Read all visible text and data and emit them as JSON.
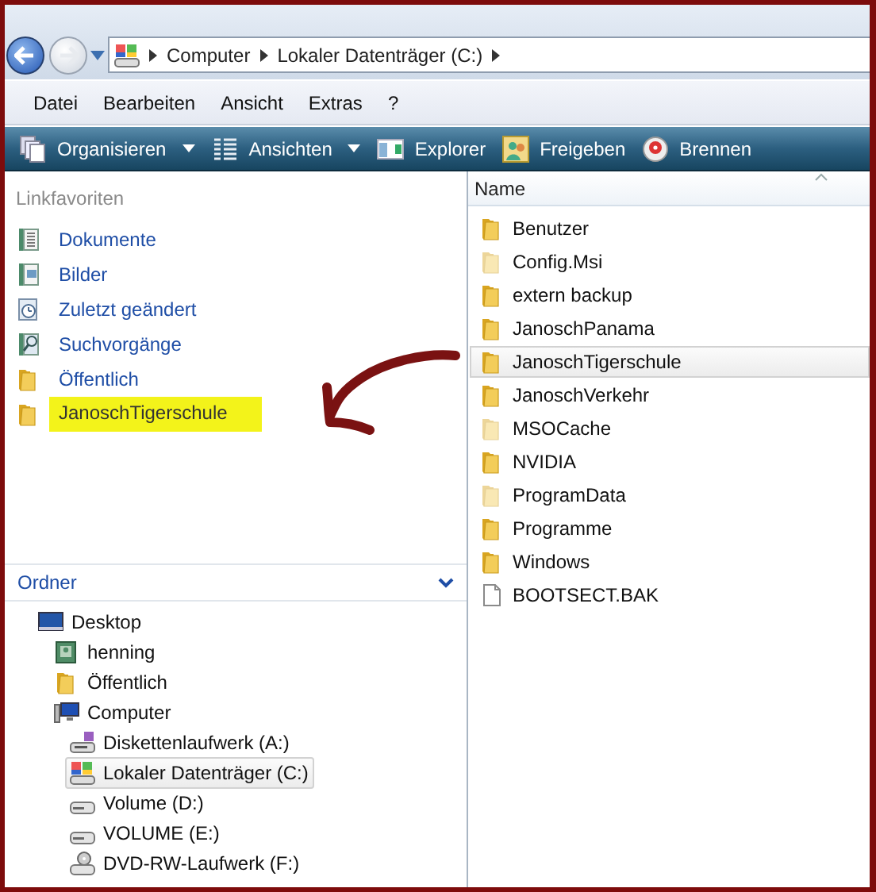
{
  "nav": {
    "back_enabled": true,
    "forward_enabled": false,
    "breadcrumb": [
      "Computer",
      "Lokaler Datenträger (C:)"
    ]
  },
  "menu": [
    "Datei",
    "Bearbeiten",
    "Ansicht",
    "Extras",
    "?"
  ],
  "toolbar": [
    {
      "label": "Organisieren",
      "kind": "organize",
      "dropdown": true
    },
    {
      "label": "Ansichten",
      "kind": "views",
      "dropdown": true
    },
    {
      "label": "Explorer",
      "kind": "explorer",
      "dropdown": false
    },
    {
      "label": "Freigeben",
      "kind": "share",
      "dropdown": false
    },
    {
      "label": "Brennen",
      "kind": "burn",
      "dropdown": false
    }
  ],
  "favorites": {
    "title": "Linkfavoriten",
    "items": [
      {
        "label": "Dokumente",
        "kind": "documents",
        "highlighted": false
      },
      {
        "label": "Bilder",
        "kind": "pictures",
        "highlighted": false
      },
      {
        "label": "Zuletzt geändert",
        "kind": "recent",
        "highlighted": false
      },
      {
        "label": "Suchvorgänge",
        "kind": "searches",
        "highlighted": false
      },
      {
        "label": "Öffentlich",
        "kind": "folder",
        "highlighted": false
      },
      {
        "label": "JanoschTigerschule",
        "kind": "folder",
        "highlighted": true
      }
    ]
  },
  "annotation": {
    "kind": "arrow"
  },
  "folders": {
    "title": "Ordner",
    "expanded": true,
    "tree": [
      {
        "label": "Desktop",
        "kind": "desktop",
        "selected": false,
        "children": [
          {
            "label": "henning",
            "kind": "user",
            "selected": false
          },
          {
            "label": "Öffentlich",
            "kind": "folder",
            "selected": false
          },
          {
            "label": "Computer",
            "kind": "computer",
            "selected": false,
            "children": [
              {
                "label": "Diskettenlaufwerk (A:)",
                "kind": "floppy",
                "selected": false
              },
              {
                "label": "Lokaler Datenträger (C:)",
                "kind": "system-drive",
                "selected": true
              },
              {
                "label": "Volume (D:)",
                "kind": "drive",
                "selected": false
              },
              {
                "label": "VOLUME (E:)",
                "kind": "drive",
                "selected": false
              },
              {
                "label": "DVD-RW-Laufwerk (F:)",
                "kind": "dvd",
                "selected": false
              }
            ]
          }
        ]
      }
    ]
  },
  "file_list": {
    "columns": [
      "Name"
    ],
    "sort_ascending": true,
    "rows": [
      {
        "name": "Benutzer",
        "kind": "folder",
        "hidden": false,
        "selected": false
      },
      {
        "name": "Config.Msi",
        "kind": "folder",
        "hidden": true,
        "selected": false
      },
      {
        "name": "extern backup",
        "kind": "folder",
        "hidden": false,
        "selected": false
      },
      {
        "name": "JanoschPanama",
        "kind": "folder",
        "hidden": false,
        "selected": false
      },
      {
        "name": "JanoschTigerschule",
        "kind": "folder",
        "hidden": false,
        "selected": true
      },
      {
        "name": "JanoschVerkehr",
        "kind": "folder",
        "hidden": false,
        "selected": false
      },
      {
        "name": "MSOCache",
        "kind": "folder",
        "hidden": true,
        "selected": false
      },
      {
        "name": "NVIDIA",
        "kind": "folder",
        "hidden": false,
        "selected": false
      },
      {
        "name": "ProgramData",
        "kind": "folder",
        "hidden": true,
        "selected": false
      },
      {
        "name": "Programme",
        "kind": "folder",
        "hidden": false,
        "selected": false
      },
      {
        "name": "Windows",
        "kind": "folder",
        "hidden": false,
        "selected": false
      },
      {
        "name": "BOOTSECT.BAK",
        "kind": "file",
        "hidden": false,
        "selected": false
      }
    ]
  }
}
